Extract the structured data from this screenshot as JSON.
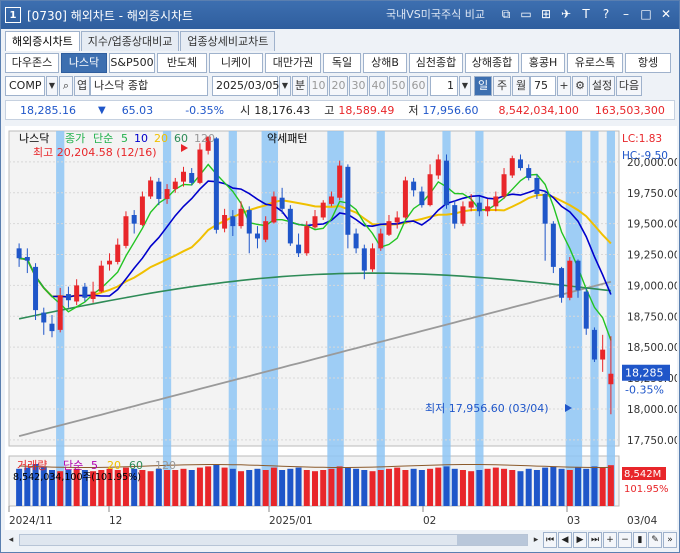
{
  "window": {
    "badge": "1",
    "title": "[0730] 해외차트 - 해외증시차트",
    "compare_label": "국내VS미국주식 비교",
    "icons": [
      "window-icon",
      "link-icon",
      "screen-icon",
      "pin-icon",
      "t-icon",
      "help-icon",
      "minimize-icon",
      "maximize-icon",
      "close-icon"
    ]
  },
  "tabs": [
    "해외증시차트",
    "지수/업종상대비교",
    "업종상세비교차트"
  ],
  "index_buttons": [
    "다우존스",
    "나스닥",
    "S&P500",
    "반도체",
    "니케이",
    "대만가권",
    "독일",
    "상해B",
    "심천종합",
    "상해종합",
    "홍콩H",
    "유로스톡",
    "항셍"
  ],
  "index_active": "나스닥",
  "toolbar": {
    "symbol": "COMP",
    "search_icon": "magnifier-icon",
    "list_label": "엽",
    "name": "나스닥 종합",
    "date": "2025/03/05",
    "unit_label": "분",
    "periods": [
      "10",
      "20",
      "30",
      "40",
      "50",
      "60"
    ],
    "count": "1",
    "day": "일",
    "week": "주",
    "month": "월",
    "bars": "75",
    "settings": "설정",
    "next": "다음"
  },
  "quote": {
    "last": "18,285.16",
    "arrow": "▼",
    "change": "65.03",
    "pct": "-0.35%",
    "open_label": "시",
    "open": "18,176.43",
    "high_label": "고",
    "high": "18,589.49",
    "low_label": "저",
    "low": "17,956.60",
    "vol": "8,542,034,100",
    "amount": "163,503,300"
  },
  "chart": {
    "legend_name": "나스닥",
    "legend_items": [
      {
        "label": "종가",
        "color": "#22b14c"
      },
      {
        "label": "단순",
        "color": "#22b14c"
      },
      {
        "label": "5",
        "color": "#22b14c"
      },
      {
        "label": "10",
        "color": "#0000cc"
      },
      {
        "label": "20",
        "color": "#f0c000"
      },
      {
        "label": "60",
        "color": "#2e8b57"
      },
      {
        "label": "120",
        "color": "#999999"
      }
    ],
    "pattern_label": "약세패턴",
    "lc_label": "LC:1.83",
    "hc_label": "HC:-9.50",
    "high_marker": "최고 20,204.58 (12/16)",
    "low_marker": "최저 17,956.60 (03/04)",
    "price_tag": "18,285",
    "pct_tag": "-0.35%",
    "y_ticks": [
      "20,000.00",
      "19,750.00",
      "19,500.00",
      "19,250.00",
      "19,000.00",
      "18,750.00",
      "18,500.00",
      "18,250.00",
      "18,000.00",
      "17,750.00"
    ],
    "x_ticks": [
      "2024/11",
      "12",
      "2025/01",
      "02",
      "03",
      "03/04"
    ],
    "volume_legend": [
      "거래량",
      "단순",
      "5",
      "20",
      "60",
      "120"
    ],
    "volume_line": "8,542,034,100주(101.95%)",
    "volume_tag": "8,542M",
    "volume_pct_tag": "101.95%",
    "up_color": "#e8262a",
    "down_color": "#1f56c9",
    "highlight_color": "#8ec5f5"
  },
  "chart_data": {
    "type": "candlestick",
    "title": "나스닥",
    "ylim": [
      17700,
      20250
    ],
    "candles": [
      [
        19300,
        19220,
        19150,
        19340
      ],
      [
        19230,
        19200,
        19100,
        19300
      ],
      [
        19150,
        18800,
        18720,
        19180
      ],
      [
        18780,
        18700,
        18600,
        18820
      ],
      [
        18690,
        18630,
        18580,
        18760
      ],
      [
        18640,
        18920,
        18620,
        18980
      ],
      [
        18930,
        18880,
        18820,
        18990
      ],
      [
        18870,
        19000,
        18840,
        19050
      ],
      [
        18990,
        18900,
        18870,
        19020
      ],
      [
        18890,
        18950,
        18860,
        19030
      ],
      [
        18950,
        19160,
        18940,
        19200
      ],
      [
        19170,
        19200,
        19120,
        19260
      ],
      [
        19190,
        19330,
        19170,
        19380
      ],
      [
        19320,
        19560,
        19300,
        19600
      ],
      [
        19570,
        19500,
        19420,
        19610
      ],
      [
        19490,
        19720,
        19480,
        19760
      ],
      [
        19720,
        19850,
        19700,
        19880
      ],
      [
        19840,
        19700,
        19650,
        19870
      ],
      [
        19700,
        19780,
        19660,
        19820
      ],
      [
        19780,
        19840,
        19750,
        19870
      ],
      [
        19840,
        19920,
        19800,
        19960
      ],
      [
        19910,
        19830,
        19810,
        19950
      ],
      [
        19830,
        20100,
        19820,
        20150
      ],
      [
        20090,
        20205,
        20060,
        20205
      ],
      [
        20190,
        19450,
        19420,
        20200
      ],
      [
        19460,
        19570,
        19430,
        19620
      ],
      [
        19560,
        19480,
        19400,
        19610
      ],
      [
        19480,
        19620,
        19460,
        19680
      ],
      [
        19610,
        19420,
        19260,
        19640
      ],
      [
        19420,
        19380,
        19300,
        19480
      ],
      [
        19370,
        19520,
        19350,
        19560
      ],
      [
        19510,
        19720,
        19500,
        19760
      ],
      [
        19710,
        19620,
        19580,
        19790
      ],
      [
        19620,
        19340,
        19320,
        19650
      ],
      [
        19330,
        19260,
        19230,
        19420
      ],
      [
        19260,
        19480,
        19240,
        19520
      ],
      [
        19470,
        19560,
        19460,
        19610
      ],
      [
        19550,
        19670,
        19530,
        19690
      ],
      [
        19660,
        19720,
        19640,
        19760
      ],
      [
        19710,
        19970,
        19690,
        20010
      ],
      [
        19960,
        19410,
        19300,
        19980
      ],
      [
        19420,
        19300,
        19260,
        19460
      ],
      [
        19300,
        19120,
        19050,
        19330
      ],
      [
        19130,
        19300,
        19110,
        19340
      ],
      [
        19300,
        19420,
        19280,
        19460
      ],
      [
        19410,
        19520,
        19400,
        19570
      ],
      [
        19510,
        19550,
        19460,
        19600
      ],
      [
        19550,
        19850,
        19540,
        19880
      ],
      [
        19840,
        19770,
        19720,
        19870
      ],
      [
        19760,
        19650,
        19630,
        19800
      ],
      [
        19650,
        19900,
        19640,
        19980
      ],
      [
        19890,
        20020,
        19860,
        20060
      ],
      [
        20010,
        19650,
        19620,
        20060
      ],
      [
        19650,
        19500,
        19460,
        19690
      ],
      [
        19500,
        19640,
        19480,
        19680
      ],
      [
        19630,
        19680,
        19600,
        19740
      ],
      [
        19670,
        19600,
        19560,
        19720
      ],
      [
        19600,
        19640,
        19560,
        19700
      ],
      [
        19640,
        19720,
        19600,
        19760
      ],
      [
        19720,
        19900,
        19700,
        19950
      ],
      [
        19890,
        20030,
        19870,
        20050
      ],
      [
        20020,
        19950,
        19930,
        20060
      ],
      [
        19950,
        19870,
        19850,
        19980
      ],
      [
        19870,
        19740,
        19700,
        19900
      ],
      [
        19740,
        19500,
        19200,
        19760
      ],
      [
        19500,
        19150,
        19100,
        19520
      ],
      [
        19140,
        18900,
        18860,
        19150
      ],
      [
        18900,
        19200,
        18880,
        19230
      ],
      [
        19200,
        18960,
        18900,
        19210
      ],
      [
        18950,
        18650,
        18600,
        18980
      ],
      [
        18640,
        18400,
        18380,
        18660
      ],
      [
        18400,
        18480,
        18300,
        18600
      ],
      [
        18200,
        18285,
        17957,
        18589
      ]
    ],
    "volume": [
      62,
      64,
      70,
      66,
      60,
      58,
      60,
      62,
      60,
      58,
      60,
      62,
      60,
      64,
      62,
      60,
      58,
      62,
      60,
      60,
      62,
      60,
      64,
      66,
      70,
      64,
      62,
      58,
      60,
      62,
      60,
      64,
      60,
      62,
      64,
      60,
      58,
      60,
      62,
      66,
      64,
      62,
      60,
      58,
      60,
      62,
      64,
      60,
      62,
      60,
      62,
      64,
      66,
      62,
      60,
      58,
      60,
      62,
      64,
      62,
      60,
      58,
      62,
      60,
      64,
      66,
      62,
      60,
      64,
      62,
      66,
      64,
      68
    ]
  }
}
